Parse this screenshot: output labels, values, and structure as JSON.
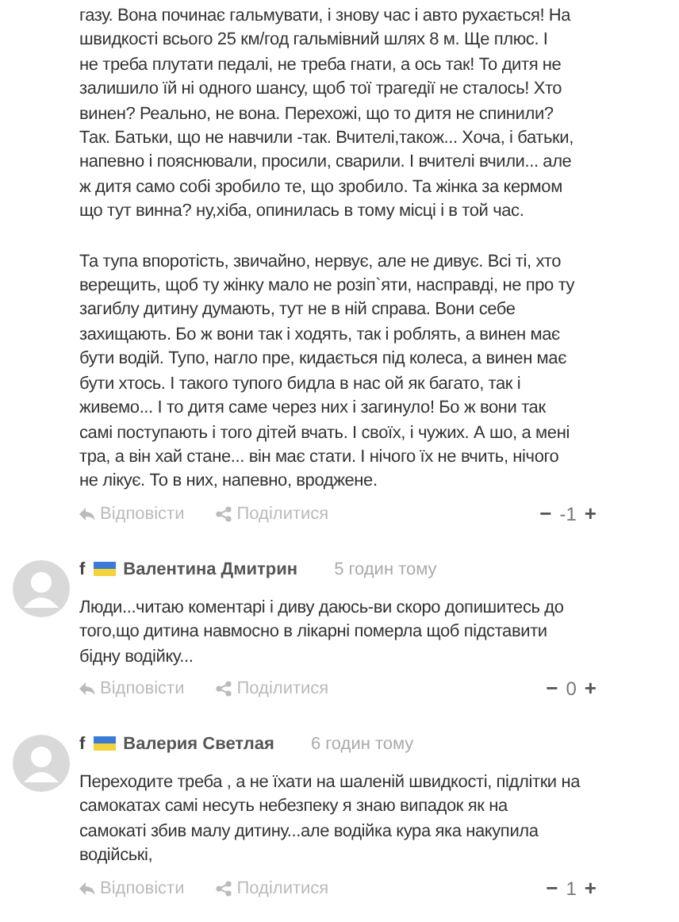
{
  "comments": [
    {
      "paragraphs": [
        "газу. Вона починає гальмувати, і знову час і авто рухається! На\nшвидкості всього 25 км/год гальмівний шлях 8 м. Ще плюс. І\nне треба плутати педалі, не треба гнати, а ось так! То дитя не\nзалишило їй ні одного шансу, щоб тої трагедії не сталось! Хто\nвинен? Реально, не вона. Перехожі, що то дитя не спинили?\nТак. Батьки, що не навчили -так. Вчителі,також... Хоча, і батьки,\nнапевно і пояснювали, просили, сварили. І вчителі вчили... але\nж дитя само собі зробило те, що зробило. Та жінка за кермом\nщо тут винна? ну,хіба, опинилась в тому місці і в той час.",
        "Та тупа впоротість, звичайно, нервує, але не дивує. Всі ті, хто\nверещить, щоб ту жінку мало не розіп`яти, насправді, не про ту\nзагиблу дитину думають, тут не в ній справа. Вони себе\nзахищають. Бо ж вони так і ходять, так і роблять, а винен має\nбути водій. Тупо, нагло пре, кидається під колеса, а винен має\nбути хтось. І такого тупого бидла в нас ой як багато, так і\nживемо... І то дитя саме через них і загинуло! Бо ж вони так\nсамі поступають і того дітей вчать. І своїх, і чужих. А шо, а мені\nтра, а він хай стане... він має стати. І нічого їх не вчить, нічого\nне лікує. То в них, напевно, вроджене."
      ],
      "reply": "Відповісти",
      "share": "Поділитися",
      "minus": "−",
      "votes": "-1",
      "plus": "+"
    },
    {
      "network": "f",
      "author": "Валентина Дмитрин",
      "time": "5 годин тому",
      "paragraphs": [
        "Люди...читаю коментарі і диву даюсь-ви скоро допишитесь до\nтого,що дитина навмосно в лікарні померла щоб підставити\nбідну  водійку..."
      ],
      "reply": "Відповісти",
      "share": "Поділитися",
      "minus": "−",
      "votes": "0",
      "plus": "+"
    },
    {
      "network": "f",
      "author": "Валерия Светлая",
      "time": "6 годин тому",
      "paragraphs": [
        "Переходите треба , а не їхати на шаленій швидкості, підлітки на\nсамокатах самі несуть небезпеку я знаю випадок як на\nсамокаті збив малу дитину...але водійка  кура яка накупила\nводійські,"
      ],
      "reply": "Відповісти",
      "share": "Поділитися",
      "minus": "−",
      "votes": "1",
      "plus": "+"
    }
  ]
}
